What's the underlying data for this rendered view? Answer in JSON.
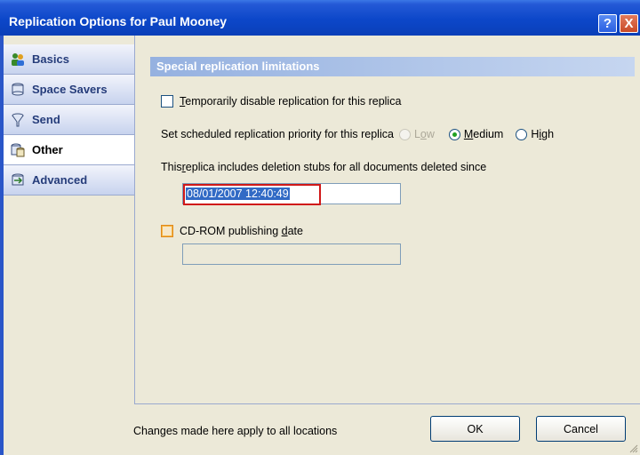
{
  "window": {
    "title": "Replication Options for Paul Mooney",
    "help_glyph": "?",
    "close_glyph": "X"
  },
  "sidebar": {
    "items": [
      {
        "label": "Basics",
        "icon": "people-icon"
      },
      {
        "label": "Space Savers",
        "icon": "database-icon"
      },
      {
        "label": "Send",
        "icon": "funnel-icon"
      },
      {
        "label": "Other",
        "icon": "database-stack-icon",
        "active": true
      },
      {
        "label": "Advanced",
        "icon": "database-arrows-icon"
      }
    ]
  },
  "main": {
    "section_title": "Special replication limitations",
    "disable_replication": {
      "label": "Temporarily disable replication for this replica",
      "accel": "T",
      "rest": "emporarily disable replication for this replica",
      "checked": false
    },
    "priority": {
      "label": "Set scheduled replication priority for this replica",
      "options": [
        {
          "label": "Low",
          "accel": "o",
          "selected": false,
          "disabled": true
        },
        {
          "label": "Medium",
          "accel": "M",
          "selected": true,
          "disabled": false
        },
        {
          "label": "High",
          "accel": "i",
          "selected": false,
          "disabled": false
        }
      ]
    },
    "deletion_stubs": {
      "label_pre": "This ",
      "label_accel": "r",
      "label_post": "eplica includes deletion stubs for all documents deleted since",
      "value": "08/01/2007 12:40:49"
    },
    "cdrom": {
      "label_pre": "CD-ROM publishing ",
      "label_accel": "d",
      "label_post": "ate",
      "checked": false,
      "value": ""
    }
  },
  "footer": {
    "note": "Changes made here apply to all locations",
    "ok_label": "OK",
    "cancel_label": "Cancel"
  },
  "colors": {
    "titlebar": "#0c47c9",
    "section_header": "#95b1e0",
    "highlight_box": "#d01818",
    "selection": "#316ac5"
  }
}
